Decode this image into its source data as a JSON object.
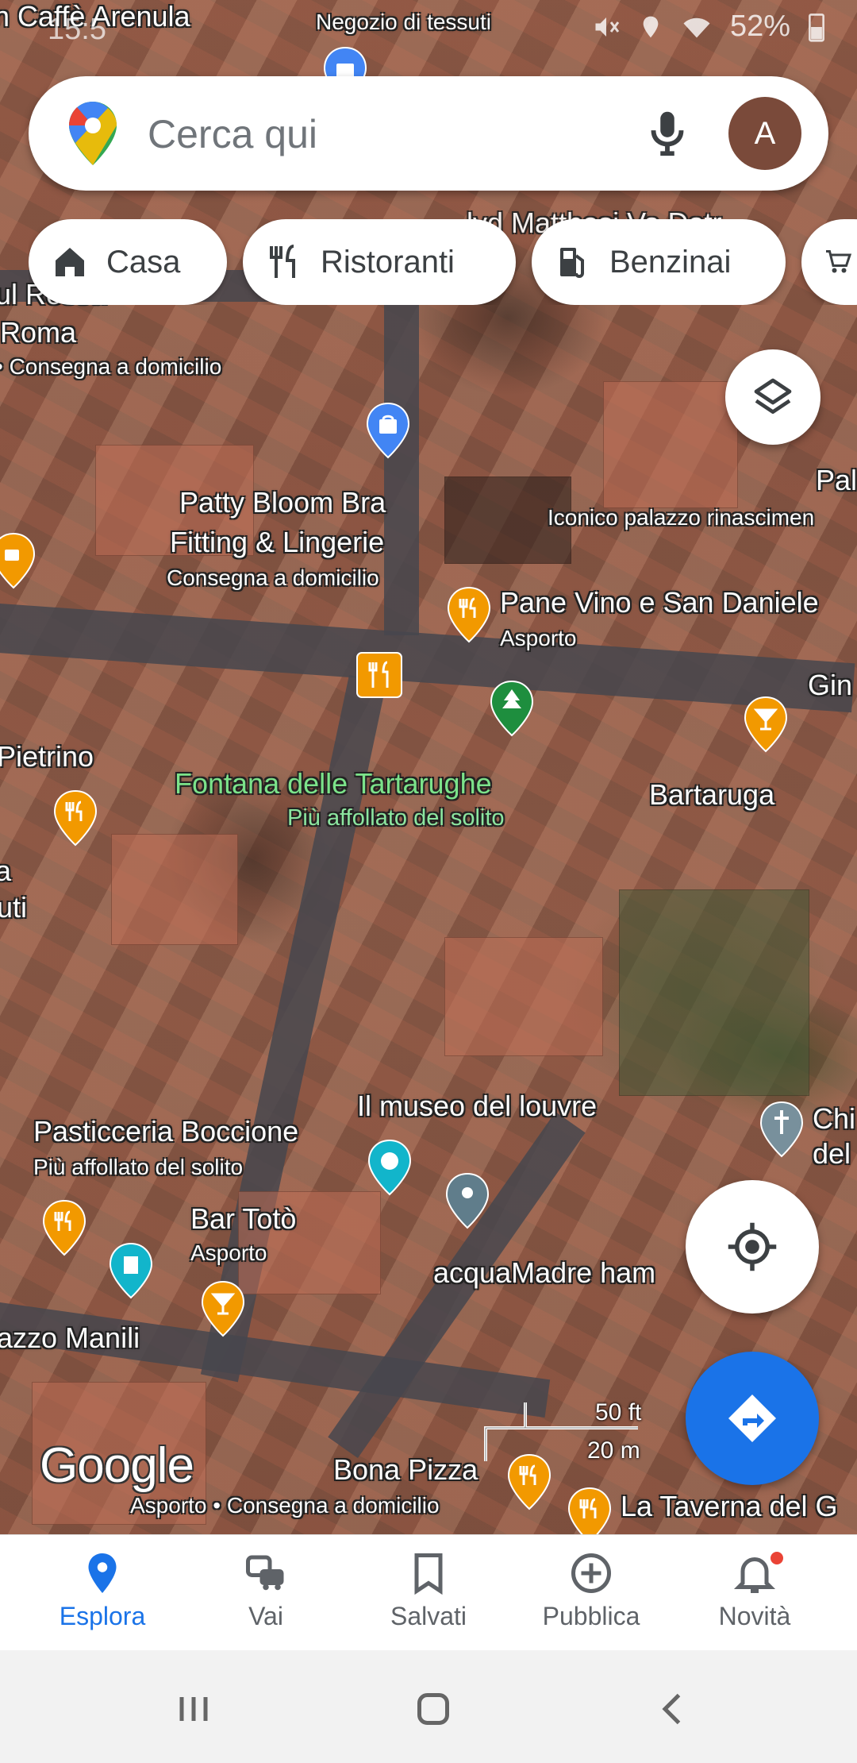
{
  "status_bar": {
    "time": "15:5",
    "battery": "52%"
  },
  "search": {
    "placeholder": "Cerca qui",
    "avatar_letter": "A"
  },
  "chips": [
    {
      "label": "Casa",
      "icon": "home-icon"
    },
    {
      "label": "Ristoranti",
      "icon": "restaurant-icon"
    },
    {
      "label": "Benzinai",
      "icon": "gas-station-icon"
    }
  ],
  "map": {
    "labels": {
      "caffe_arenula": "n Caffè Arenula",
      "negozio_tessuti": "Negozio di tessuti",
      "ul_rossa": "ul Rossa",
      "roma": "Roma",
      "consegna": "• Consegna a domicilio",
      "lvd": "lvd Matthosi Va Datr",
      "patty1": "Patty Bloom Bra",
      "patty2": "Fitting & Lingerie",
      "patty3": "Consegna a domicilio",
      "pal": "Pal",
      "iconico": "Iconico palazzo rinascimen",
      "pane_vino": "Pane Vino e San Daniele",
      "asporto1": "Asporto",
      "gin": "Gin",
      "pietrino": "Pietrino",
      "fontana": "Fontana delle Tartarughe",
      "fontana_sub": "Più affollato del solito",
      "bartaruga": "Bartaruga",
      "a": "a",
      "uti": "uti",
      "museo": "Il museo del louvre",
      "chi": "Chi",
      "del": "del",
      "pasticceria": "Pasticceria Boccione",
      "pasticceria_sub": "Più affollato del solito",
      "bar_toto": "Bar Totò",
      "asporto2": "Asporto",
      "acquamadre": "acquaMadre ham",
      "palazzo_manili": "azzo Manili",
      "bona_pizza": "Bona Pizza",
      "bona_sub": "Asporto • Consegna a domicilio",
      "taverna": "La Taverna del G"
    },
    "watermark": "Google",
    "scale_ft": "50 ft",
    "scale_m": "20 m"
  },
  "bottom_nav": [
    {
      "label": "Esplora",
      "icon": "explore-pin-icon",
      "active": true
    },
    {
      "label": "Vai",
      "icon": "commute-icon",
      "active": false
    },
    {
      "label": "Salvati",
      "icon": "bookmark-icon",
      "active": false
    },
    {
      "label": "Pubblica",
      "icon": "add-circle-icon",
      "active": false
    },
    {
      "label": "Novità",
      "icon": "bell-icon",
      "active": false,
      "badge": true
    }
  ],
  "colors": {
    "accent": "#1a73e8",
    "restaurant_pin": "#f29900",
    "shopping_pin": "#4285f4",
    "park_pin": "#1e8e3e",
    "museum_pin": "#12b5cb",
    "badge": "#ea4335"
  }
}
